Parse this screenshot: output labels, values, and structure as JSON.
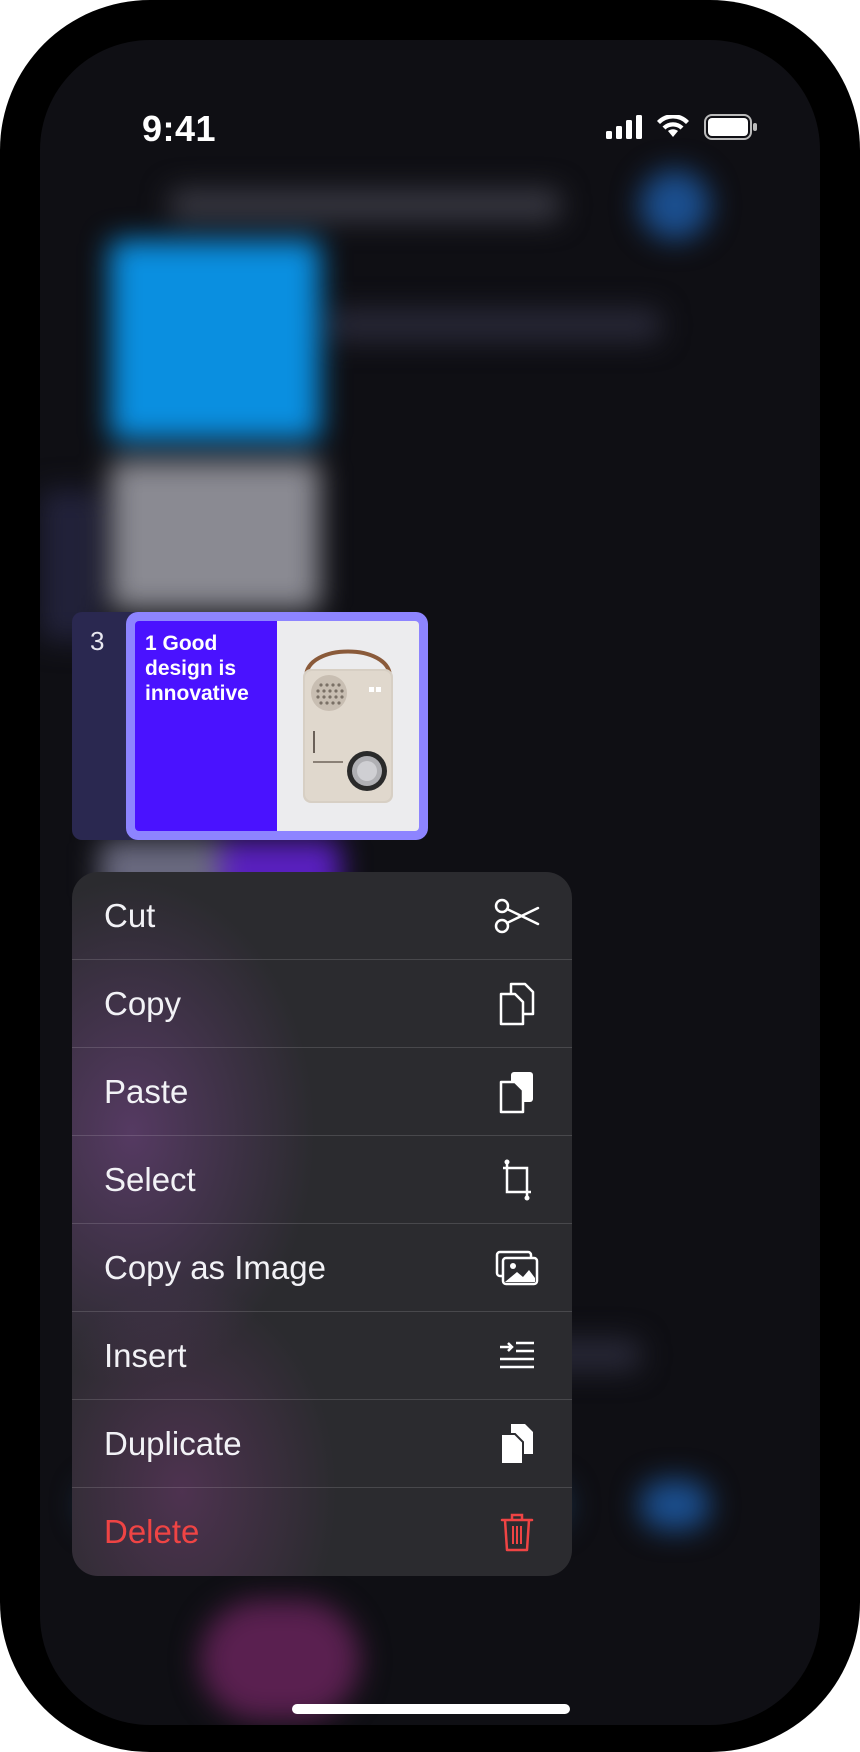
{
  "status_bar": {
    "time": "9:41"
  },
  "slide": {
    "number": "3",
    "title": "1 Good design is innovative"
  },
  "context_menu": {
    "items": [
      {
        "label": "Cut",
        "icon": "scissors-icon"
      },
      {
        "label": "Copy",
        "icon": "copy-icon"
      },
      {
        "label": "Paste",
        "icon": "paste-icon"
      },
      {
        "label": "Select",
        "icon": "crop-select-icon"
      },
      {
        "label": "Copy as Image",
        "icon": "photo-icon"
      },
      {
        "label": "Insert",
        "icon": "insert-list-icon"
      },
      {
        "label": "Duplicate",
        "icon": "duplicate-icon"
      },
      {
        "label": "Delete",
        "icon": "trash-icon",
        "destructive": true
      }
    ]
  },
  "colors": {
    "accent_slide": "#4a12ff",
    "selection_border": "#8d84ff",
    "destructive": "#ef4444"
  }
}
